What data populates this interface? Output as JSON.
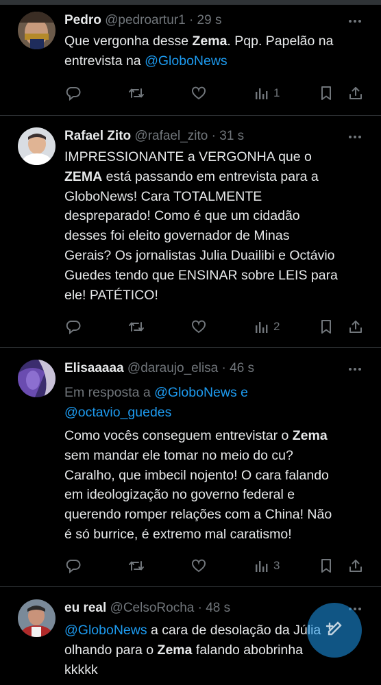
{
  "tweets": [
    {
      "name": "Pedro",
      "handle": "@pedroartur1",
      "time": "· 29 s",
      "body": [
        {
          "t": "Que vergonha desse "
        },
        {
          "t": "Zema",
          "b": true
        },
        {
          "t": ". Pqp. Papelão na"
        },
        {
          "br": true
        },
        {
          "t": "entrevista na "
        },
        {
          "t": "@GloboNews",
          "link": true
        }
      ],
      "views": "1"
    },
    {
      "name": "Rafael Zito",
      "handle": "@rafael_zito",
      "time": "· 31 s",
      "body": [
        {
          "t": "IMPRESSIONANTE a VERGONHA que o"
        },
        {
          "br": true
        },
        {
          "t": "ZEMA",
          "b": true
        },
        {
          "t": " está passando em entrevista para a"
        },
        {
          "br": true
        },
        {
          "t": "GloboNews! Cara TOTALMENTE"
        },
        {
          "br": true
        },
        {
          "t": "despreparado! Como é que um cidadão"
        },
        {
          "br": true
        },
        {
          "t": "desses foi eleito governador de Minas"
        },
        {
          "br": true
        },
        {
          "t": "Gerais? Os jornalistas Julia Duailibi e Octávio"
        },
        {
          "br": true
        },
        {
          "t": "Guedes tendo que ENSINAR sobre LEIS para"
        },
        {
          "br": true
        },
        {
          "t": "ele! PATÉTICO!"
        }
      ],
      "views": "2"
    },
    {
      "name": "Elisaaaaa",
      "handle": "@daraujo_elisa",
      "time": "· 46 s",
      "reply_prefix": "Em resposta a ",
      "reply_to_1": "@GloboNews",
      "reply_and": " e",
      "reply_to_2": "@octavio_guedes",
      "body": [
        {
          "t": "Como vocês conseguem entrevistar o "
        },
        {
          "t": "Zema",
          "b": true
        },
        {
          "br": true
        },
        {
          "t": "sem mandar ele tomar no meio do cu?"
        },
        {
          "br": true
        },
        {
          "t": "Caralho, que imbecil nojento! O cara falando"
        },
        {
          "br": true
        },
        {
          "t": "em ideologização no governo federal e"
        },
        {
          "br": true
        },
        {
          "t": "querendo romper relações com a China! Não"
        },
        {
          "br": true
        },
        {
          "t": "é só burrice, é extremo mal caratismo!"
        }
      ],
      "views": "3"
    },
    {
      "name": "eu real",
      "handle": "@CelsoRocha",
      "time": "· 48 s",
      "body": [
        {
          "t": "@GloboNews",
          "link": true
        },
        {
          "t": " a cara de desolação da Júlia"
        },
        {
          "br": true
        },
        {
          "t": "olhando para o "
        },
        {
          "t": "Zema",
          "b": true
        },
        {
          "t": " falando abobrinha"
        },
        {
          "br": true
        },
        {
          "t": "kkkkk"
        }
      ]
    }
  ],
  "colors": {
    "accent": "#1d9bf0",
    "muted": "#71767b",
    "text": "#e7e9ea",
    "border": "#2f3336"
  },
  "icons": [
    "reply-icon",
    "retweet-icon",
    "like-icon",
    "views-icon",
    "bookmark-icon",
    "share-icon",
    "more-icon",
    "compose-icon"
  ]
}
